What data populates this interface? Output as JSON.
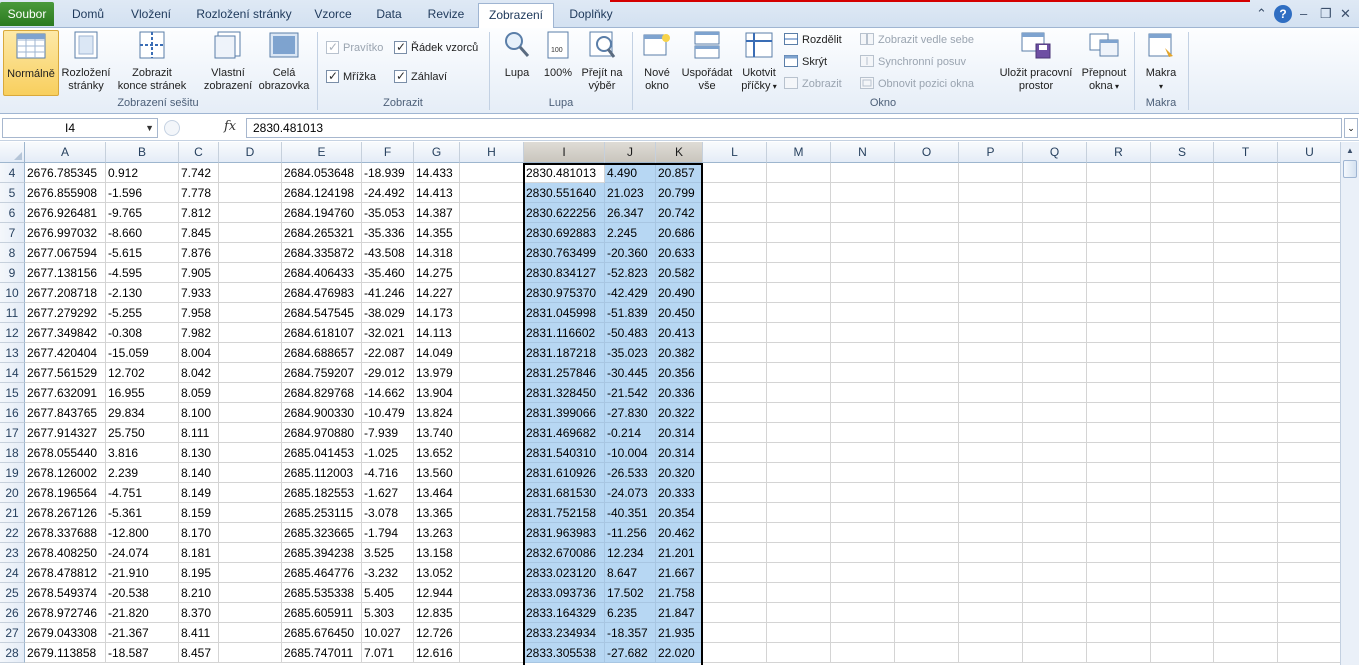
{
  "ribbon_tabs": {
    "file": "Soubor",
    "tabs": [
      "Domů",
      "Vložení",
      "Rozložení stránky",
      "Vzorce",
      "Data",
      "Revize",
      "Zobrazení",
      "Doplňky"
    ],
    "active": "Zobrazení"
  },
  "groups": {
    "workbook_views": {
      "label": "Zobrazení sešitu",
      "normal": "Normálně",
      "page_layout_1": "Rozložení",
      "page_layout_2": "stránky",
      "page_break_1": "Zobrazit",
      "page_break_2": "konce stránek",
      "custom_1": "Vlastní",
      "custom_2": "zobrazení",
      "fullscreen_1": "Celá",
      "fullscreen_2": "obrazovka"
    },
    "show": {
      "label": "Zobrazit",
      "ruler": "Pravítko",
      "formula_bar": "Řádek vzorců",
      "gridlines": "Mřížka",
      "headings": "Záhlaví"
    },
    "zoom": {
      "label": "Lupa",
      "zoom": "Lupa",
      "hundred": "100%",
      "zoom_sel_1": "Přejít na",
      "zoom_sel_2": "výběr"
    },
    "window": {
      "label": "Okno",
      "new_1": "Nové",
      "new_2": "okno",
      "arrange_1": "Uspořádat",
      "arrange_2": "vše",
      "freeze_1": "Ukotvit",
      "freeze_2": "příčky",
      "split": "Rozdělit",
      "hide": "Skrýt",
      "unhide": "Zobrazit",
      "side_by_side": "Zobrazit vedle sebe",
      "sync_scroll": "Synchronní posuv",
      "reset_pos": "Obnovit pozici okna",
      "save_ws_1": "Uložit pracovní",
      "save_ws_2": "prostor",
      "switch_1": "Přepnout",
      "switch_2": "okna"
    },
    "macros": {
      "label": "Makra",
      "macros": "Makra"
    }
  },
  "formula_bar": {
    "name_box": "I4",
    "fx": "fx",
    "value": "2830.481013"
  },
  "columns": [
    "A",
    "B",
    "C",
    "D",
    "E",
    "F",
    "G",
    "H",
    "I",
    "J",
    "K",
    "L",
    "M",
    "N",
    "O",
    "P",
    "Q",
    "R",
    "S",
    "T",
    "U"
  ],
  "selected_columns": [
    "I",
    "J",
    "K"
  ],
  "rows": [
    {
      "n": "4",
      "A": "2676.785345",
      "B": "0.912",
      "C": "7.742",
      "E": "2684.053648",
      "F": "-18.939",
      "G": "14.433",
      "I": "2830.481013",
      "J": "4.490",
      "K": "20.857"
    },
    {
      "n": "5",
      "A": "2676.855908",
      "B": "-1.596",
      "C": "7.778",
      "E": "2684.124198",
      "F": "-24.492",
      "G": "14.413",
      "I": "2830.551640",
      "J": "21.023",
      "K": "20.799"
    },
    {
      "n": "6",
      "A": "2676.926481",
      "B": "-9.765",
      "C": "7.812",
      "E": "2684.194760",
      "F": "-35.053",
      "G": "14.387",
      "I": "2830.622256",
      "J": "26.347",
      "K": "20.742"
    },
    {
      "n": "7",
      "A": "2676.997032",
      "B": "-8.660",
      "C": "7.845",
      "E": "2684.265321",
      "F": "-35.336",
      "G": "14.355",
      "I": "2830.692883",
      "J": "2.245",
      "K": "20.686"
    },
    {
      "n": "8",
      "A": "2677.067594",
      "B": "-5.615",
      "C": "7.876",
      "E": "2684.335872",
      "F": "-43.508",
      "G": "14.318",
      "I": "2830.763499",
      "J": "-20.360",
      "K": "20.633"
    },
    {
      "n": "9",
      "A": "2677.138156",
      "B": "-4.595",
      "C": "7.905",
      "E": "2684.406433",
      "F": "-35.460",
      "G": "14.275",
      "I": "2830.834127",
      "J": "-52.823",
      "K": "20.582"
    },
    {
      "n": "10",
      "A": "2677.208718",
      "B": "-2.130",
      "C": "7.933",
      "E": "2684.476983",
      "F": "-41.246",
      "G": "14.227",
      "I": "2830.975370",
      "J": "-42.429",
      "K": "20.490"
    },
    {
      "n": "11",
      "A": "2677.279292",
      "B": "-5.255",
      "C": "7.958",
      "E": "2684.547545",
      "F": "-38.029",
      "G": "14.173",
      "I": "2831.045998",
      "J": "-51.839",
      "K": "20.450"
    },
    {
      "n": "12",
      "A": "2677.349842",
      "B": "-0.308",
      "C": "7.982",
      "E": "2684.618107",
      "F": "-32.021",
      "G": "14.113",
      "I": "2831.116602",
      "J": "-50.483",
      "K": "20.413"
    },
    {
      "n": "13",
      "A": "2677.420404",
      "B": "-15.059",
      "C": "8.004",
      "E": "2684.688657",
      "F": "-22.087",
      "G": "14.049",
      "I": "2831.187218",
      "J": "-35.023",
      "K": "20.382"
    },
    {
      "n": "14",
      "A": "2677.561529",
      "B": "12.702",
      "C": "8.042",
      "E": "2684.759207",
      "F": "-29.012",
      "G": "13.979",
      "I": "2831.257846",
      "J": "-30.445",
      "K": "20.356"
    },
    {
      "n": "15",
      "A": "2677.632091",
      "B": "16.955",
      "C": "8.059",
      "E": "2684.829768",
      "F": "-14.662",
      "G": "13.904",
      "I": "2831.328450",
      "J": "-21.542",
      "K": "20.336"
    },
    {
      "n": "16",
      "A": "2677.843765",
      "B": "29.834",
      "C": "8.100",
      "E": "2684.900330",
      "F": "-10.479",
      "G": "13.824",
      "I": "2831.399066",
      "J": "-27.830",
      "K": "20.322"
    },
    {
      "n": "17",
      "A": "2677.914327",
      "B": "25.750",
      "C": "8.111",
      "E": "2684.970880",
      "F": "-7.939",
      "G": "13.740",
      "I": "2831.469682",
      "J": "-0.214",
      "K": "20.314"
    },
    {
      "n": "18",
      "A": "2678.055440",
      "B": "3.816",
      "C": "8.130",
      "E": "2685.041453",
      "F": "-1.025",
      "G": "13.652",
      "I": "2831.540310",
      "J": "-10.004",
      "K": "20.314"
    },
    {
      "n": "19",
      "A": "2678.126002",
      "B": "2.239",
      "C": "8.140",
      "E": "2685.112003",
      "F": "-4.716",
      "G": "13.560",
      "I": "2831.610926",
      "J": "-26.533",
      "K": "20.320"
    },
    {
      "n": "20",
      "A": "2678.196564",
      "B": "-4.751",
      "C": "8.149",
      "E": "2685.182553",
      "F": "-1.627",
      "G": "13.464",
      "I": "2831.681530",
      "J": "-24.073",
      "K": "20.333"
    },
    {
      "n": "21",
      "A": "2678.267126",
      "B": "-5.361",
      "C": "8.159",
      "E": "2685.253115",
      "F": "-3.078",
      "G": "13.365",
      "I": "2831.752158",
      "J": "-40.351",
      "K": "20.354"
    },
    {
      "n": "22",
      "A": "2678.337688",
      "B": "-12.800",
      "C": "8.170",
      "E": "2685.323665",
      "F": "-1.794",
      "G": "13.263",
      "I": "2831.963983",
      "J": "-11.256",
      "K": "20.462"
    },
    {
      "n": "23",
      "A": "2678.408250",
      "B": "-24.074",
      "C": "8.181",
      "E": "2685.394238",
      "F": "3.525",
      "G": "13.158",
      "I": "2832.670086",
      "J": "12.234",
      "K": "21.201"
    },
    {
      "n": "24",
      "A": "2678.478812",
      "B": "-21.910",
      "C": "8.195",
      "E": "2685.464776",
      "F": "-3.232",
      "G": "13.052",
      "I": "2833.023120",
      "J": "8.647",
      "K": "21.667"
    },
    {
      "n": "25",
      "A": "2678.549374",
      "B": "-20.538",
      "C": "8.210",
      "E": "2685.535338",
      "F": "5.405",
      "G": "12.944",
      "I": "2833.093736",
      "J": "17.502",
      "K": "21.758"
    },
    {
      "n": "26",
      "A": "2678.972746",
      "B": "-21.820",
      "C": "8.370",
      "E": "2685.605911",
      "F": "5.303",
      "G": "12.835",
      "I": "2833.164329",
      "J": "6.235",
      "K": "21.847"
    },
    {
      "n": "27",
      "A": "2679.043308",
      "B": "-21.367",
      "C": "8.411",
      "E": "2685.676450",
      "F": "10.027",
      "G": "12.726",
      "I": "2833.234934",
      "J": "-18.357",
      "K": "21.935"
    },
    {
      "n": "28",
      "A": "2679.113858",
      "B": "-18.587",
      "C": "8.457",
      "E": "2685.747011",
      "F": "7.071",
      "G": "12.616",
      "I": "2833.305538",
      "J": "-27.682",
      "K": "22.020"
    }
  ],
  "colors": {
    "file_tab": "#2b7a1f",
    "selection": "#b7d7f3",
    "selected_header": "#c9c5bd"
  }
}
